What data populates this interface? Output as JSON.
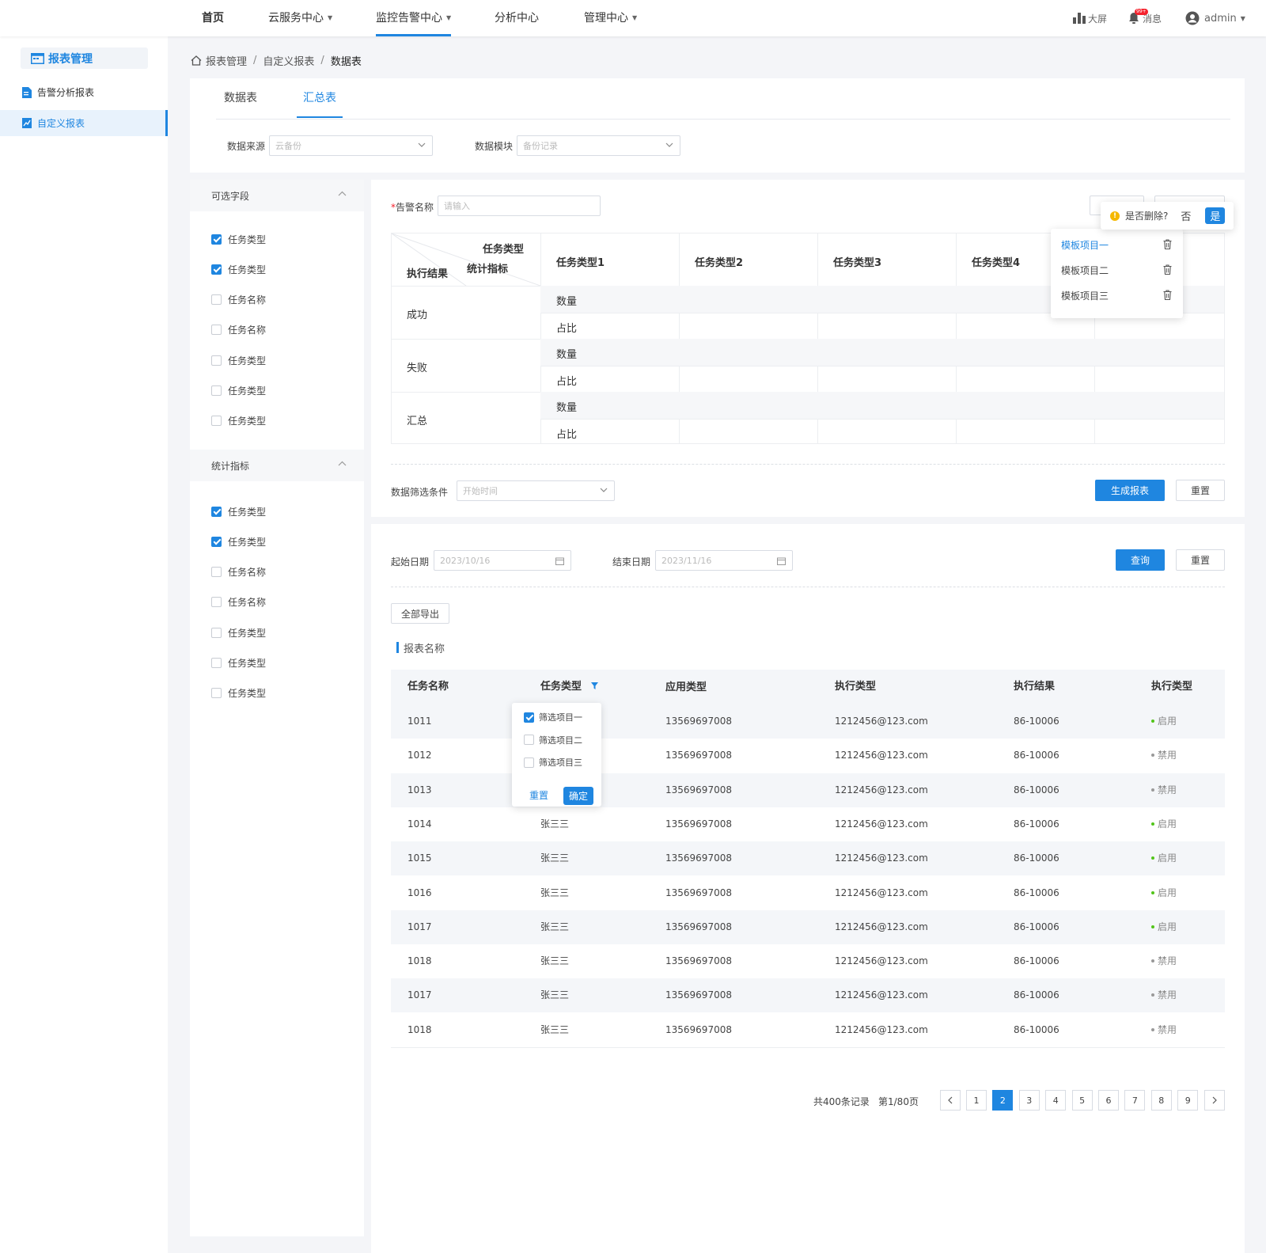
{
  "nav": {
    "items": [
      {
        "label": "首页",
        "caret": false
      },
      {
        "label": "云服务中心",
        "caret": true
      },
      {
        "label": "监控告警中心",
        "caret": true
      },
      {
        "label": "分析中心",
        "caret": false
      },
      {
        "label": "管理中心",
        "caret": true
      }
    ],
    "active_index": 2,
    "bigscreen": "大屏",
    "messages": "消息",
    "message_badge": "99+",
    "user": "admin"
  },
  "sidebar": {
    "title": "报表管理",
    "items": [
      {
        "label": "告警分析报表",
        "active": false
      },
      {
        "label": "自定义报表",
        "active": true
      }
    ]
  },
  "breadcrumb": [
    "报表管理",
    "自定义报表",
    "数据表"
  ],
  "tabs": [
    {
      "label": "数据表",
      "active": false
    },
    {
      "label": "汇总表",
      "active": true
    }
  ],
  "source_filter": {
    "source_label": "数据来源",
    "source_placeholder": "云备份",
    "module_label": "数据模块",
    "module_placeholder": "备份记录"
  },
  "fields_panel": {
    "optional_title": "可选字段",
    "optional": [
      {
        "label": "任务类型",
        "checked": true
      },
      {
        "label": "任务类型",
        "checked": true
      },
      {
        "label": "任务名称",
        "checked": false
      },
      {
        "label": "任务名称",
        "checked": false
      },
      {
        "label": "任务类型",
        "checked": false
      },
      {
        "label": "任务类型",
        "checked": false
      },
      {
        "label": "任务类型",
        "checked": false
      }
    ],
    "metrics_title": "统计指标",
    "metrics": [
      {
        "label": "任务类型",
        "checked": true
      },
      {
        "label": "任务类型",
        "checked": true
      },
      {
        "label": "任务名称",
        "checked": false
      },
      {
        "label": "任务名称",
        "checked": false
      },
      {
        "label": "任务类型",
        "checked": false
      },
      {
        "label": "任务类型",
        "checked": false
      },
      {
        "label": "任务类型",
        "checked": false
      }
    ]
  },
  "summary": {
    "alarm_label": "告警名称",
    "alarm_required": "*",
    "alarm_placeholder": "请输入",
    "corner": {
      "col": "任务类型",
      "mid": "统计指标",
      "row": "执行结果"
    },
    "columns": [
      "任务类型1",
      "任务类型2",
      "任务类型3",
      "任务类型4"
    ],
    "groups": [
      {
        "name": "成功",
        "metrics": [
          "数量",
          "占比"
        ]
      },
      {
        "name": "失败",
        "metrics": [
          "数量",
          "占比"
        ]
      },
      {
        "name": "汇总",
        "metrics": [
          "数量",
          "占比"
        ]
      }
    ],
    "filter_label": "数据筛选条件",
    "filter_placeholder": "开始时间",
    "generate_btn": "生成报表",
    "reset_btn": "重置"
  },
  "confirm_pop": {
    "text": "是否删除?",
    "no": "否",
    "yes": "是"
  },
  "template_pop": {
    "items": [
      {
        "label": "模板项目一",
        "active": true
      },
      {
        "label": "模板项目二",
        "active": false
      },
      {
        "label": "模板项目三",
        "active": false
      }
    ]
  },
  "query": {
    "start_label": "起始日期",
    "start_value": "2023/10/16",
    "end_label": "结束日期",
    "end_value": "2023/11/16",
    "query_btn": "查询",
    "reset_btn": "重置",
    "export_btn": "全部导出",
    "report_title": "报表名称"
  },
  "table": {
    "headers": [
      "任务名称",
      "任务类型",
      "应用类型",
      "执行类型",
      "执行结果",
      "执行类型"
    ],
    "rows": [
      {
        "name": "1011",
        "type": "",
        "app": "13569697008",
        "exec": "1212456@123.com",
        "result": "86-10006",
        "status": "启用"
      },
      {
        "name": "1012",
        "type": "",
        "app": "13569697008",
        "exec": "1212456@123.com",
        "result": "86-10006",
        "status": "禁用"
      },
      {
        "name": "1013",
        "type": "",
        "app": "13569697008",
        "exec": "1212456@123.com",
        "result": "86-10006",
        "status": "禁用"
      },
      {
        "name": "1014",
        "type": "张三三",
        "app": "13569697008",
        "exec": "1212456@123.com",
        "result": "86-10006",
        "status": "启用"
      },
      {
        "name": "1015",
        "type": "张三三",
        "app": "13569697008",
        "exec": "1212456@123.com",
        "result": "86-10006",
        "status": "启用"
      },
      {
        "name": "1016",
        "type": "张三三",
        "app": "13569697008",
        "exec": "1212456@123.com",
        "result": "86-10006",
        "status": "启用"
      },
      {
        "name": "1017",
        "type": "张三三",
        "app": "13569697008",
        "exec": "1212456@123.com",
        "result": "86-10006",
        "status": "启用"
      },
      {
        "name": "1018",
        "type": "张三三",
        "app": "13569697008",
        "exec": "1212456@123.com",
        "result": "86-10006",
        "status": "禁用"
      },
      {
        "name": "1017",
        "type": "张三三",
        "app": "13569697008",
        "exec": "1212456@123.com",
        "result": "86-10006",
        "status": "禁用"
      },
      {
        "name": "1018",
        "type": "张三三",
        "app": "13569697008",
        "exec": "1212456@123.com",
        "result": "86-10006",
        "status": "禁用"
      }
    ],
    "status_colors": {
      "启用": "#52c41a",
      "禁用": "#999999"
    }
  },
  "filter_pop": {
    "items": [
      {
        "label": "筛选项目一",
        "checked": true
      },
      {
        "label": "筛选项目二",
        "checked": false
      },
      {
        "label": "筛选项目三",
        "checked": false
      }
    ],
    "reset": "重置",
    "ok": "确定"
  },
  "pagination": {
    "total_text": "共400条记录",
    "page_text": "第1/80页",
    "pages": [
      "1",
      "2",
      "3",
      "4",
      "5",
      "6",
      "7",
      "8",
      "9"
    ],
    "current": "2"
  },
  "colors": {
    "accent": "#1f86e0",
    "enabled": "#52c41a",
    "disabled": "#999999",
    "warning": "#f5b800"
  }
}
